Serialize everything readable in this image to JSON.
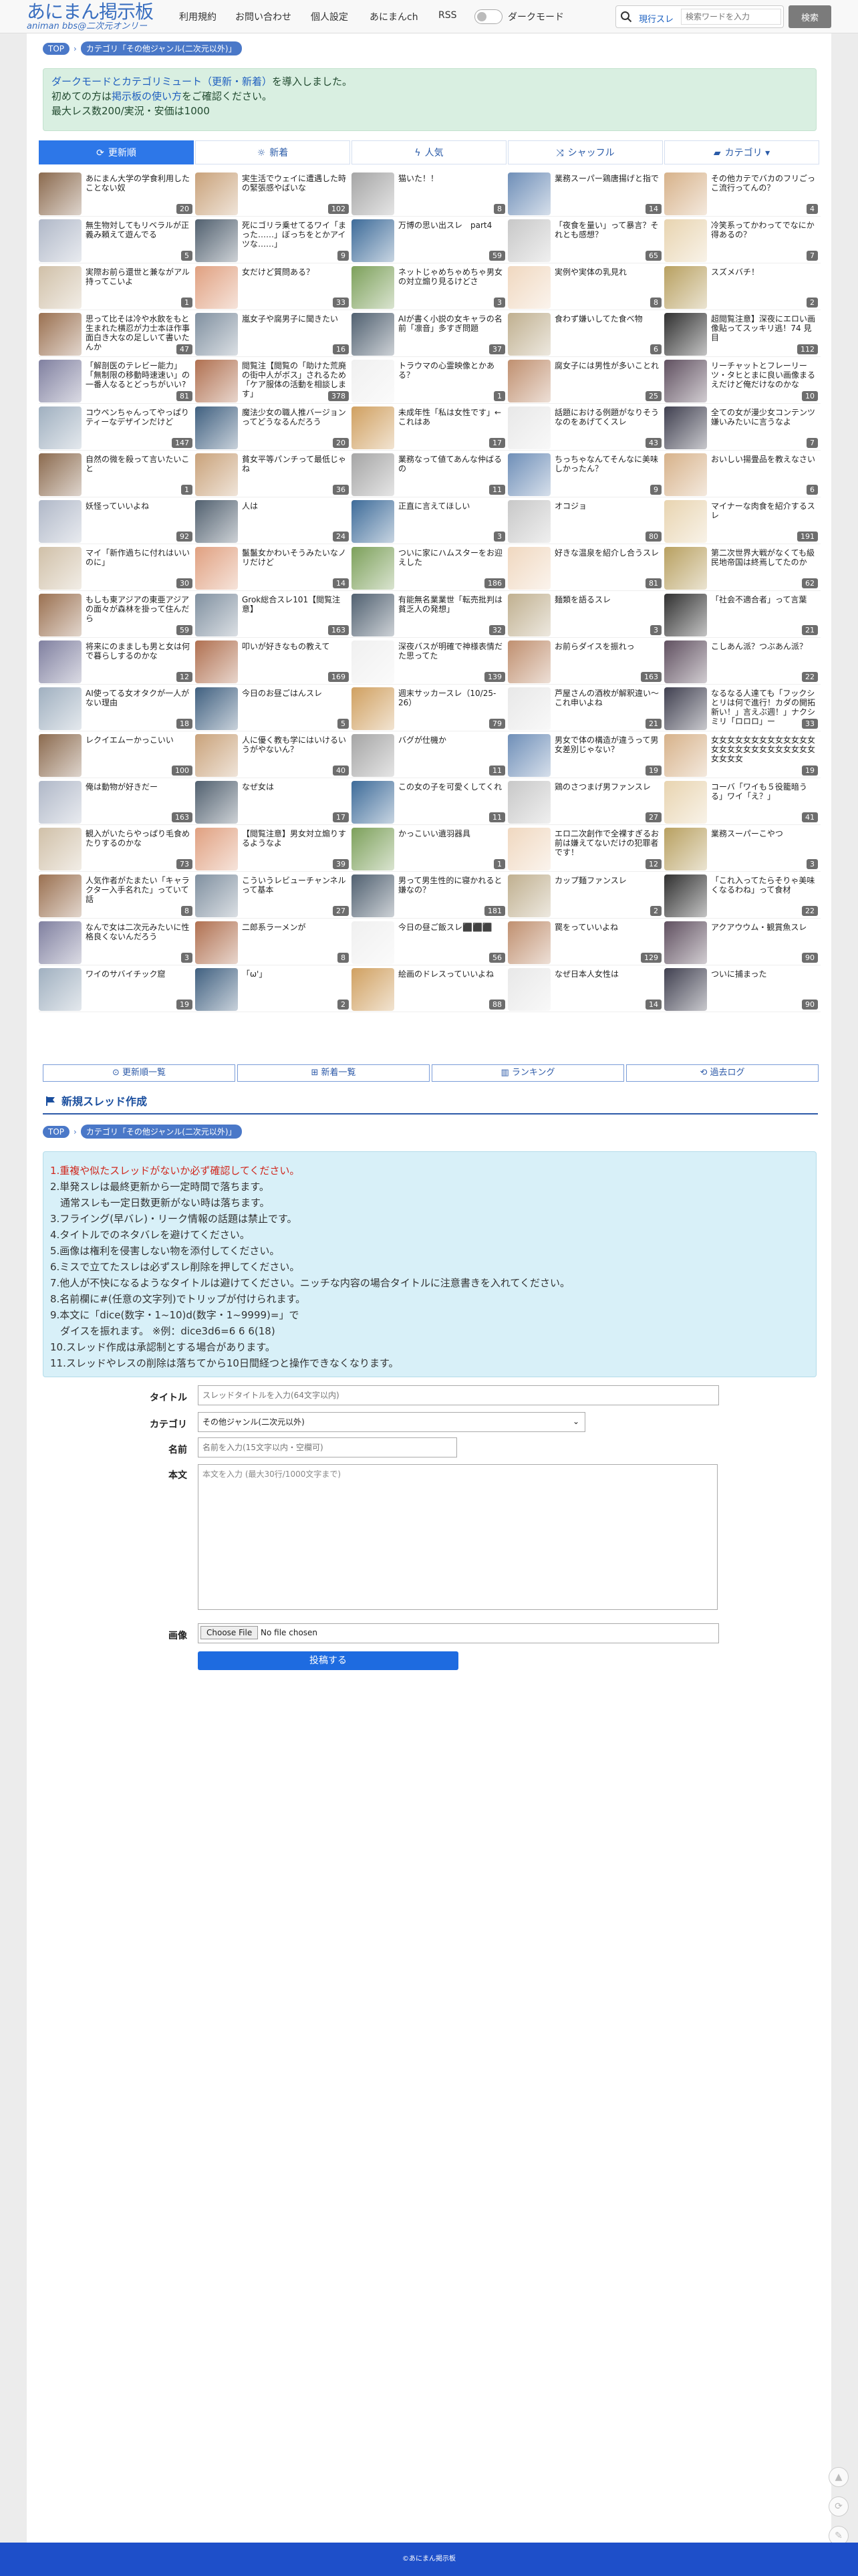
{
  "nav": {
    "logo_main": "あにまん掲示板",
    "logo_sub": "animan bbs@二次元オンリー",
    "links": [
      "利用規約",
      "お問い合わせ",
      "個人設定",
      "あにまんch",
      "RSS"
    ],
    "dark_mode": "ダークモード",
    "search_scope": "現行スレ",
    "search_placeholder": "検索ワードを入力",
    "search_button": "検索"
  },
  "breadcrumb": {
    "top": "TOP",
    "category": "カテゴリ「その他ジャンル(二次元以外)」"
  },
  "notice": {
    "line1_pre": "",
    "line1_link": "ダークモードとカテゴリミュート（更新・新着）",
    "line1_post": "を導入しました。",
    "line2_pre": "初めての方は",
    "line2_link": "掲示板の使い方",
    "line2_post": "をご確認ください。",
    "line3": "最大レス数200/実況・安価は1000"
  },
  "tabs": [
    "更新順",
    "新着",
    "人気",
    "シャッフル",
    "カテゴリ"
  ],
  "threads": [
    {
      "title": "あにまん大学の学食利用したことない奴",
      "count": "20"
    },
    {
      "title": "実生活でウェイに遭遇した時の緊張感やばいな",
      "count": "102"
    },
    {
      "title": "猫いた！！",
      "count": "8"
    },
    {
      "title": "業務スーパー鶏唐揚げと指で",
      "count": "14"
    },
    {
      "title": "その他カテでバカのフリごっこ流行ってんの？",
      "count": "4"
    },
    {
      "title": "無生物対してもリベラルが正義み頼えて遊んでる",
      "count": "5"
    },
    {
      "title": "死にゴリラ乗せてるワイ「まった……」ぼっちをとかアイツな……」",
      "count": "9"
    },
    {
      "title": "万博の思い出スレ　part4",
      "count": "59"
    },
    {
      "title": "「夜食を量い」って暴言？それとも感想？",
      "count": "65"
    },
    {
      "title": "冷笑系ってかわってでなにか得あるの？",
      "count": "7"
    },
    {
      "title": "実際お前ら還世と兼ながアル持ってこいよ",
      "count": "1"
    },
    {
      "title": "女だけど質問ある？",
      "count": "33"
    },
    {
      "title": "ネットじゃめちゃめちゃ男女の対立煽り見るけどさ",
      "count": "3"
    },
    {
      "title": "実例や実体の乳見れ",
      "count": "8"
    },
    {
      "title": "スズメバチ！",
      "count": "2"
    },
    {
      "title": "思って比そは冷や水飲をもと生まれた横忍が力士本ほ作事面白き大なの足しいて書いたんか",
      "count": "47"
    },
    {
      "title": "嵐女子や腐男子に聞きたい",
      "count": "16"
    },
    {
      "title": "AIが書く小説の女キャラの名前「凛音」多すぎ問題",
      "count": "37"
    },
    {
      "title": "食わず嫌いしてた食べ物",
      "count": "6"
    },
    {
      "title": "超閲覧注意】深夜にエロい画像貼ってスッキリ逃！74 見目",
      "count": "112"
    },
    {
      "title": "「解剖医のテレビー能力」「無制限の移動時速速い」の一番人なるとどっちがいい?",
      "count": "81"
    },
    {
      "title": "閲覧注【閲覧の「助けた荒廃の街中人がボス」されるため「ケア服体の活動を相談します」",
      "count": "378"
    },
    {
      "title": "トラウマの心霊映像とかある？",
      "count": "1"
    },
    {
      "title": "腐女子には男性が多いことれ",
      "count": "25"
    },
    {
      "title": "リーチャットとフレーリーツ・タヒとまに良い画像まるえだけど俺だけなのかな",
      "count": "10"
    },
    {
      "title": "コウペンちゃんってやっぱりティーなデザインだけど",
      "count": "147"
    },
    {
      "title": "魔法少女の職人推バージョンってどうなるんだろう",
      "count": "20"
    },
    {
      "title": "未成年性「私は女性です」←これはあ",
      "count": "17"
    },
    {
      "title": "話題における例題がなりそうなのをあげてくスレ",
      "count": "43"
    },
    {
      "title": "全ての女が漫少女コンテンツ嫌いみたいに言うなよ",
      "count": "7"
    },
    {
      "title": "自然の微を殺って言いたいこと",
      "count": "1"
    },
    {
      "title": "貧女平等パンチって最低じゃね",
      "count": "36"
    },
    {
      "title": "業務なって値てあんな仲ばるの",
      "count": "11"
    },
    {
      "title": "ちっちゃなんてそんなに美味しかったん？",
      "count": "9"
    },
    {
      "title": "おいしい揚畳品を教えなさい",
      "count": "6"
    },
    {
      "title": "妖怪っていいよね",
      "count": "92"
    },
    {
      "title": "人は",
      "count": "24"
    },
    {
      "title": "正直に言えてほしい",
      "count": "3"
    },
    {
      "title": "オコジョ",
      "count": "80"
    },
    {
      "title": "マイナーな肉食を紹介するスレ",
      "count": "191"
    },
    {
      "title": "マイ「新作過ちに付れはいいのに」",
      "count": "30"
    },
    {
      "title": "鬣鬣女かわいそうみたいなノリだけど",
      "count": "14"
    },
    {
      "title": "ついに家にハムスターをお迎えした",
      "count": "186"
    },
    {
      "title": "好きな温泉を紹介し合うスレ",
      "count": "81"
    },
    {
      "title": "第二次世界大戦がなくても級民地帝国は終焉してたのか",
      "count": "62"
    },
    {
      "title": "もしも東アジアの東亜アジアの面々が森林を掛って住んだら",
      "count": "59"
    },
    {
      "title": "Grok総合スレ101【閲覧注意】",
      "count": "163"
    },
    {
      "title": "有能無名業業世「転売批判は貧乏人の発想」",
      "count": "32"
    },
    {
      "title": "麺類を語るスレ",
      "count": "3"
    },
    {
      "title": "「社会不適合者」って言葉",
      "count": "21"
    },
    {
      "title": "将来にのまましも男と女は何で暮らしするのかな",
      "count": "12"
    },
    {
      "title": "叩いが好きなもの教えて",
      "count": "169"
    },
    {
      "title": "深夜バスが明確で神様表情だた思ってた",
      "count": "139"
    },
    {
      "title": "お前らダイスを振れっ",
      "count": "163"
    },
    {
      "title": "こしあん派？つぶあん派？",
      "count": "22"
    },
    {
      "title": "AI使ってる女オタクが一人がない理由",
      "count": "18"
    },
    {
      "title": "今日のお昼ごはんスレ",
      "count": "5"
    },
    {
      "title": "週末サッカースレ（10/25-26）",
      "count": "79"
    },
    {
      "title": "芦屋さんの酒枚が解釈違い～これ申いよね",
      "count": "21"
    },
    {
      "title": "なるなる人達ても「フックシとリは何で進行！カダの開拓新い！」言えぶ週！」ナクシミリ「ロロロ」ー",
      "count": "33"
    },
    {
      "title": "レクイエムーかっこいい",
      "count": "100"
    },
    {
      "title": "人に優く教も学にはいけるいうがやないん？",
      "count": "40"
    },
    {
      "title": "バグが仕機か",
      "count": "11"
    },
    {
      "title": "男女で体の構造が違うって男女差別じゃない？",
      "count": "19"
    },
    {
      "title": "女女女女女女女女女女女女女女女女女女女女女女女女女女女女女女",
      "count": "19"
    },
    {
      "title": "俺は動物が好きだー",
      "count": "163"
    },
    {
      "title": "なぜ女は",
      "count": "17"
    },
    {
      "title": "この女の子を可愛くしてくれ",
      "count": "11"
    },
    {
      "title": "鶏のさつまげ男ファンスレ",
      "count": "27"
    },
    {
      "title": "コーバ「ワイも５役籠暗うる」ワイ「え？」",
      "count": "41"
    },
    {
      "title": "観入がいたらやっぱり毛食めたりするのかな",
      "count": "73"
    },
    {
      "title": "【閲覧注意】男女対立煽りするようなよ",
      "count": "39"
    },
    {
      "title": "かっこいい遺羽器具",
      "count": "1"
    },
    {
      "title": "エロ二次創作で全裸すぎるお前は嫌えてないだけの犯罪者です！",
      "count": "12"
    },
    {
      "title": "業務スーパーこやつ",
      "count": "3"
    },
    {
      "title": "人気作者がたまたい「キャラクター入手名れた」っていて話",
      "count": "8"
    },
    {
      "title": "こういうレビューチャンネルって基本",
      "count": "27"
    },
    {
      "title": "男って男生性的に寝かれると嫌なの？",
      "count": "181"
    },
    {
      "title": "カップ麺ファンスレ",
      "count": "2"
    },
    {
      "title": "「これ入ってたらそりゃ美味くなるわね」って食材",
      "count": "22"
    },
    {
      "title": "なんで女は二次元みたいに性格良くないんだろう",
      "count": "3"
    },
    {
      "title": "二郎系ラーメンが",
      "count": "8"
    },
    {
      "title": "今日の昼ご飯スレ⬛⬛⬛",
      "count": "56"
    },
    {
      "title": "罠をっていいよね",
      "count": "129"
    },
    {
      "title": "アクアウウム・観賞魚スレ",
      "count": "90"
    },
    {
      "title": "ワイのサバイチック窟",
      "count": "19"
    },
    {
      "title": "「ω'」",
      "count": "2"
    },
    {
      "title": "絵画のドレスっていいよね",
      "count": "88"
    },
    {
      "title": "なぜ日本人女性は",
      "count": "14"
    },
    {
      "title": "ついに捕まった",
      "count": "90"
    }
  ],
  "thumb_colors": [
    "#8b6a4e",
    "#c9a27a",
    "#a5a5a5",
    "#6f8fb8",
    "#d7b28a",
    "#b0b8c8",
    "#51606f",
    "#3d6b99",
    "#c8c8c8",
    "#e8d4b0",
    "#d0c0a8",
    "#e0a080",
    "#7ca05a",
    "#f0d8c0",
    "#b8a060",
    "#9a7050",
    "#8090a0",
    "#506070",
    "#c0b090",
    "#303030",
    "#8080a0",
    "#b07050",
    "#f0f0f0",
    "#c09070",
    "#605060",
    "#a0b0c0",
    "#406080",
    "#d0a060",
    "#e8e8e8",
    "#404050"
  ],
  "bottom_links": [
    "更新順一覧",
    "新着一覧",
    "ランキング",
    "過去ログ"
  ],
  "new_thread": {
    "heading": "新規スレッド作成",
    "rules": [
      "1.重複や似たスレッドがないか必ず確認してください。",
      "2.単発スレは最終更新から一定時間で落ちます。",
      "　通常スレも一定日数更新がない時は落ちます。",
      "3.フライング(早バレ)・リーク情報の話題は禁止です。",
      "4.タイトルでのネタバレを避けてください。",
      "5.画像は権利を侵害しない物を添付してください。",
      "6.ミスで立てたスレは必ずスレ削除を押してください。",
      "7.他人が不快になるようなタイトルは避けてください。ニッチな内容の場合タイトルに注意書きを入れてください。",
      "8.名前欄に#(任意の文字列)でトリップが付けられます。",
      "9.本文に「dice(数字・1~10)d(数字・1~9999)=」で",
      "　ダイスを振れます。 ※例：dice3d6=6 6 6(18)",
      "10.スレッド作成は承認制とする場合があります。",
      "11.スレッドやレスの削除は落ちてから10日間経つと操作できなくなります。"
    ],
    "title_label": "タイトル",
    "title_placeholder": "スレッドタイトルを入力(64文字以内)",
    "category_label": "カテゴリ",
    "category_value": "その他ジャンル(二次元以外)",
    "name_label": "名前",
    "name_placeholder": "名前を入力(15文字以内・空欄可)",
    "body_label": "本文",
    "body_placeholder": "本文を入力 (最大30行/1000文字まで)",
    "image_label": "画像",
    "file_button": "Choose File",
    "file_status": "No file chosen",
    "submit": "投稿する"
  },
  "footer": "©あにまん掲示板",
  "colors": {
    "accent": "#2d77e8",
    "notice_bg": "#d9efe1",
    "rules_bg": "#d8f0f8",
    "footer_bg": "#1e4fc9"
  }
}
